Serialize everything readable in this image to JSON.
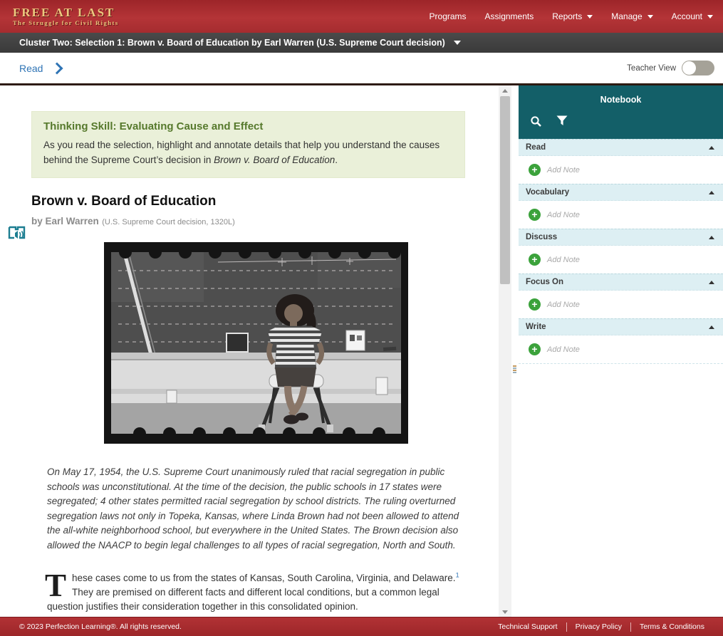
{
  "header": {
    "logo_title": "FREE AT LAST",
    "logo_subtitle": "The Struggle for Civil Rights",
    "nav": [
      {
        "label": "Programs"
      },
      {
        "label": "Assignments"
      },
      {
        "label": "Reports"
      },
      {
        "label": "Manage"
      },
      {
        "label": "Account"
      }
    ]
  },
  "cluster_bar": {
    "title": "Cluster Two: Selection 1: Brown v. Board of Education by Earl Warren (U.S. Supreme Court decision)"
  },
  "toolbar": {
    "breadcrumb": "Read",
    "teacher_view_label": "Teacher View",
    "teacher_view_state": "off"
  },
  "article": {
    "thinking_skill": {
      "heading": "Thinking Skill: Evaluating Cause and Effect",
      "body_before_italic": "As you read the selection, highlight and annotate details that help you understand the causes behind the Supreme Court’s decision in ",
      "body_italic": "Brown v. Board of Education",
      "body_after": "."
    },
    "title": "Brown v. Board of Education",
    "byline_name": "by Earl Warren",
    "byline_suffix": "(U.S. Supreme Court decision, 1320L)",
    "intro_italic": "On May 17, 1954, the U.S. Supreme Court unanimously ruled that racial segregation in public schools was unconstitutional. At the time of the decision, the public schools in 17 states were segregated; 4 other states permitted racial segregation by school districts. The ruling overturned segregation laws not only in Topeka, Kansas, where Linda Brown had not been allowed to attend the all-white neighborhood school, but everywhere in the United States. The Brown decision also allowed the NAACP to begin legal challenges to all types of racial segregation, North and South.",
    "paragraph": {
      "dropcap": "T",
      "text1": "hese cases come to us from the states of Kansas, South Carolina, Virginia, and Delaware.",
      "footnote_ref": "1",
      "text2": " They are premised on different facts and different local conditions, but a common legal question justifies their consideration together in this consolidated opinion."
    }
  },
  "notebook": {
    "title": "Notebook",
    "add_note_label": "Add Note",
    "sections": [
      {
        "label": "Read"
      },
      {
        "label": "Vocabulary"
      },
      {
        "label": "Discuss"
      },
      {
        "label": "Focus On"
      },
      {
        "label": "Write"
      }
    ]
  },
  "footer": {
    "copyright": "© 2023 Perfection Learning®. All rights reserved.",
    "links": [
      "Technical Support",
      "Privacy Policy",
      "Terms & Conditions"
    ]
  },
  "icons": {
    "plus": "+"
  },
  "colors": {
    "header_red": "#b43437",
    "notebook_teal": "#135f68",
    "section_blue": "#ddeff3",
    "skill_green_bg": "#eaf0d9",
    "skill_green_text": "#56792c",
    "link_blue": "#2f74b5",
    "add_note_green": "#3ba23b"
  }
}
